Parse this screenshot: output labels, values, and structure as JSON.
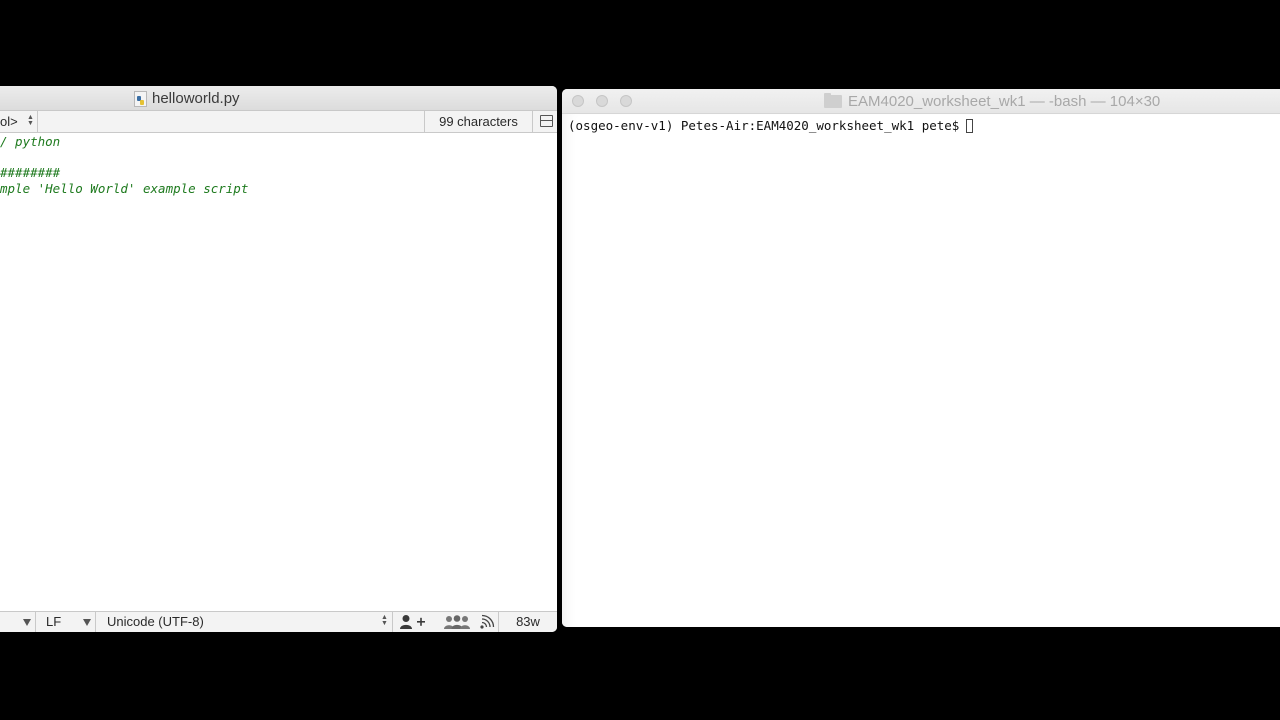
{
  "editor": {
    "title": "helloworld.py",
    "navbar": {
      "symbol_popup": "ol>",
      "char_count": "99 characters"
    },
    "code_lines": [
      "/ python",
      "",
      "########",
      "mple 'Hello World' example script"
    ],
    "statusbar": {
      "line_ending": "LF",
      "encoding": "Unicode (UTF-8)",
      "word_count": "83w"
    },
    "colors": {
      "comment": "#1e7a1e"
    }
  },
  "terminal": {
    "title": "EAM4020_worksheet_wk1 — -bash — 104×30",
    "prompt": "(osgeo-env-v1) Petes-Air:EAM4020_worksheet_wk1 pete$"
  },
  "icons": {
    "editor_file": "python-file-icon",
    "terminal_folder": "folder-icon",
    "collab": [
      "person-add-icon",
      "group-icon",
      "broadcast-icon"
    ]
  }
}
